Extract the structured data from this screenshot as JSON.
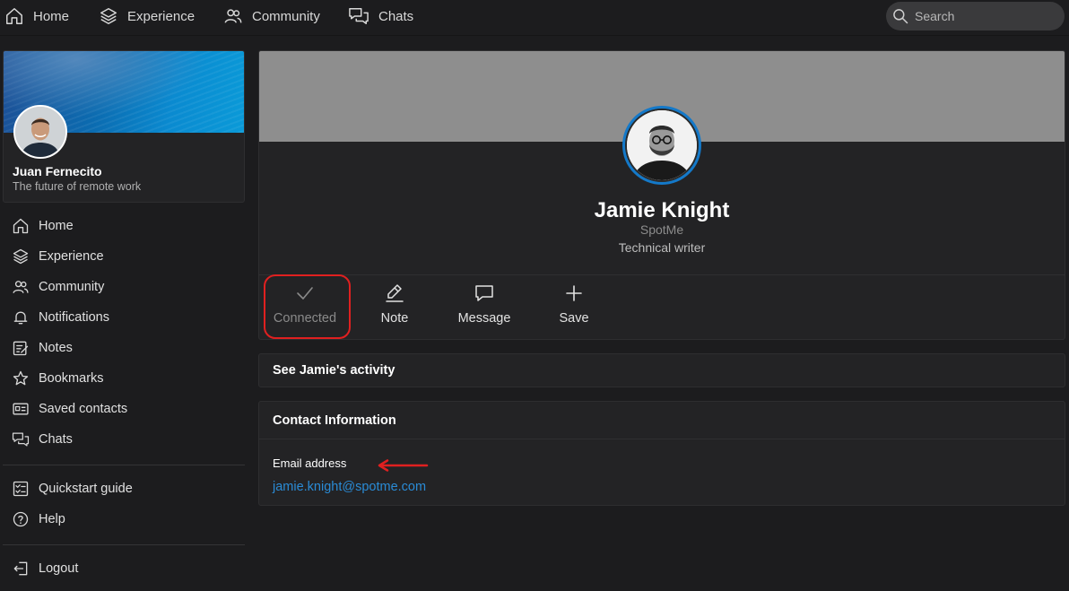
{
  "topnav": {
    "items": [
      {
        "label": "Home",
        "icon": "home-icon"
      },
      {
        "label": "Experience",
        "icon": "layers-icon"
      },
      {
        "label": "Community",
        "icon": "people-icon"
      },
      {
        "label": "Chats",
        "icon": "chat-bubbles-icon"
      }
    ],
    "search_placeholder": "Search"
  },
  "me": {
    "name": "Juan Fernecito",
    "tagline": "The future of remote work"
  },
  "sidebar": {
    "items": [
      {
        "label": "Home",
        "icon": "home-icon"
      },
      {
        "label": "Experience",
        "icon": "layers-icon"
      },
      {
        "label": "Community",
        "icon": "people-icon"
      },
      {
        "label": "Notifications",
        "icon": "bell-icon"
      },
      {
        "label": "Notes",
        "icon": "notes-icon"
      },
      {
        "label": "Bookmarks",
        "icon": "star-icon"
      },
      {
        "label": "Saved contacts",
        "icon": "contact-card-icon"
      },
      {
        "label": "Chats",
        "icon": "chat-bubbles-icon"
      }
    ],
    "secondary": [
      {
        "label": "Quickstart guide",
        "icon": "checklist-icon"
      },
      {
        "label": "Help",
        "icon": "help-icon"
      }
    ],
    "logout": {
      "label": "Logout",
      "icon": "logout-icon"
    }
  },
  "profile": {
    "name": "Jamie Knight",
    "company": "SpotMe",
    "title": "Technical writer",
    "actions": [
      {
        "label": "Connected",
        "icon": "check-icon",
        "state": "disabled"
      },
      {
        "label": "Note",
        "icon": "pencil-icon"
      },
      {
        "label": "Message",
        "icon": "message-icon"
      },
      {
        "label": "Save",
        "icon": "plus-icon"
      }
    ]
  },
  "activity": {
    "label": "See Jamie's activity"
  },
  "contact": {
    "heading": "Contact Information",
    "email_label": "Email address",
    "email": "jamie.knight@spotme.com"
  },
  "colors": {
    "accent": "#2a8bd6",
    "annotation": "#e02020"
  }
}
